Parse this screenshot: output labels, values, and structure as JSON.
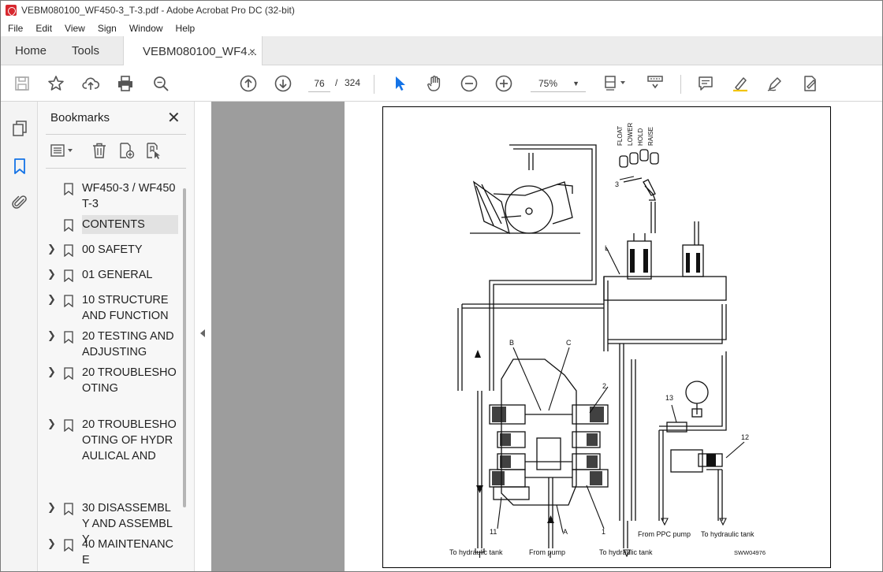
{
  "window": {
    "title": "VEBM080100_WF450-3_T-3.pdf - Adobe Acrobat Pro DC (32-bit)"
  },
  "menu": [
    "File",
    "Edit",
    "View",
    "Sign",
    "Window",
    "Help"
  ],
  "tabs": {
    "home": "Home",
    "tools": "Tools",
    "document": "VEBM080100_WF4...",
    "close": "×"
  },
  "toolbar": {
    "current_page": "76",
    "separator": "/",
    "total_pages": "324",
    "zoom": "75%"
  },
  "bookmarks_panel": {
    "title": "Bookmarks",
    "close": "✕",
    "items": [
      {
        "label": "WF450-3 / WF450T-3",
        "expandable": false
      },
      {
        "label": "CONTENTS",
        "expandable": false,
        "selected": true
      },
      {
        "label": "00 SAFETY",
        "expandable": true
      },
      {
        "label": "01 GENERAL",
        "expandable": true
      },
      {
        "label": "10 STRUCTURE AND FUNCTION",
        "expandable": true
      },
      {
        "label": "20 TESTING AND ADJUSTING",
        "expandable": true
      },
      {
        "label": "20 TROUBLESHOOTING",
        "expandable": true
      },
      {
        "label": "20 TROUBLESHOOTING OF HYDRAULICAL AND",
        "expandable": true
      },
      {
        "label": "30 DISASSEMBLY AND ASSEMBLY",
        "expandable": true
      },
      {
        "label": "40 MAINTENANCE",
        "expandable": true
      }
    ]
  },
  "diagram": {
    "lever_positions": [
      "FLOAT",
      "LOWER",
      "HOLD",
      "RAISE"
    ],
    "callouts": [
      "3",
      "L",
      "B",
      "C",
      "2",
      "13",
      "12",
      "11",
      "A",
      "1"
    ],
    "bottom_labels": {
      "tank_left": "To hydraulic tank",
      "pump": "From pump",
      "tank_mid": "To hydraulic tank",
      "ppc_pump": "From PPC pump",
      "tank_right": "To hydraulic tank"
    },
    "figure_code": "SWW04976"
  },
  "colors": {
    "acrobat_red": "#d7282f",
    "acrobat_blue": "#1473e6",
    "doc_background": "#9d9d9d"
  }
}
